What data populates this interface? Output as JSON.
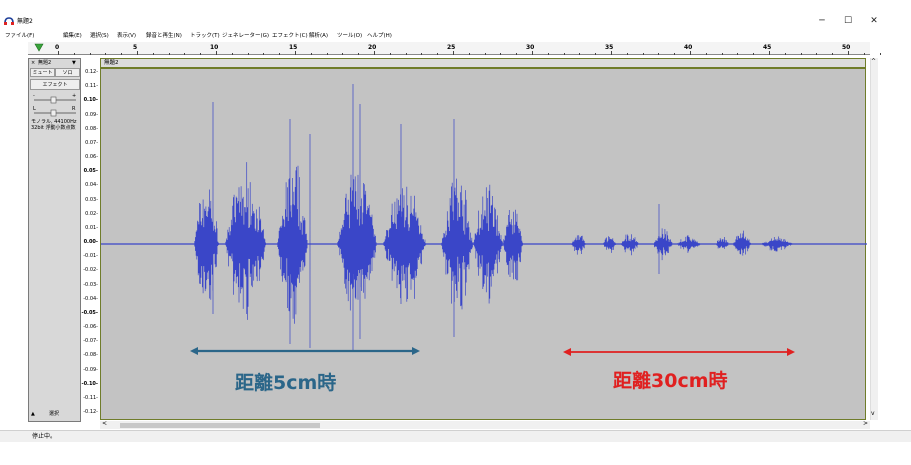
{
  "window": {
    "title": "無題2",
    "minimize": "─",
    "maximize": "☐",
    "close": "✕"
  },
  "menu": [
    "ファイル(F)",
    "編集(E)",
    "選択(S)",
    "表示(V)",
    "録音と再生(N)",
    "トラック(T)",
    "ジェネレーター(G)",
    "エフェクト(C)",
    "解析(A)",
    "ツール(O)",
    "ヘルプ(H)"
  ],
  "timeline": {
    "ticks": [
      "0",
      "5",
      "10",
      "15",
      "20",
      "25",
      "30",
      "35",
      "40",
      "45",
      "50"
    ]
  },
  "track_panel": {
    "close": "×",
    "name": "無題2",
    "dropdown": "▼",
    "mute": "ミュート",
    "solo": "ソロ",
    "effects": "エフェクト",
    "gain_minus": "-",
    "gain_plus": "+",
    "pan_left": "L",
    "pan_right": "R",
    "format_line1": "モノラル, 44100Hz",
    "format_line2": "32bit 浮動小数点数",
    "collapse": "▲",
    "select": "選択"
  },
  "clip": {
    "name": "無題2"
  },
  "y_axis": [
    "0.12-",
    "0.11-",
    "0.10-",
    "0.09-",
    "0.08-",
    "0.07-",
    "0.06-",
    "0.05-",
    "0.04-",
    "0.03-",
    "0.02-",
    "0.01-",
    "0.00-",
    "-0.01-",
    "-0.02-",
    "-0.03-",
    "-0.04-",
    "-0.05-",
    "-0.06-",
    "-0.07-",
    "-0.08-",
    "-0.09-",
    "-0.10-",
    "-0.11-",
    "-0.12-"
  ],
  "annotations": {
    "near": {
      "label": "距離5cm時",
      "color": "#2b6689"
    },
    "far": {
      "label": "距離30cm時",
      "color": "#e02020"
    }
  },
  "colors": {
    "waveform": "#3a46c8",
    "wave_bg": "#c3c3c3",
    "play_green": "#39a33b"
  },
  "scroll": {
    "left": "<",
    "right": ">",
    "up": "^",
    "down": "v"
  },
  "status": "停止中。"
}
